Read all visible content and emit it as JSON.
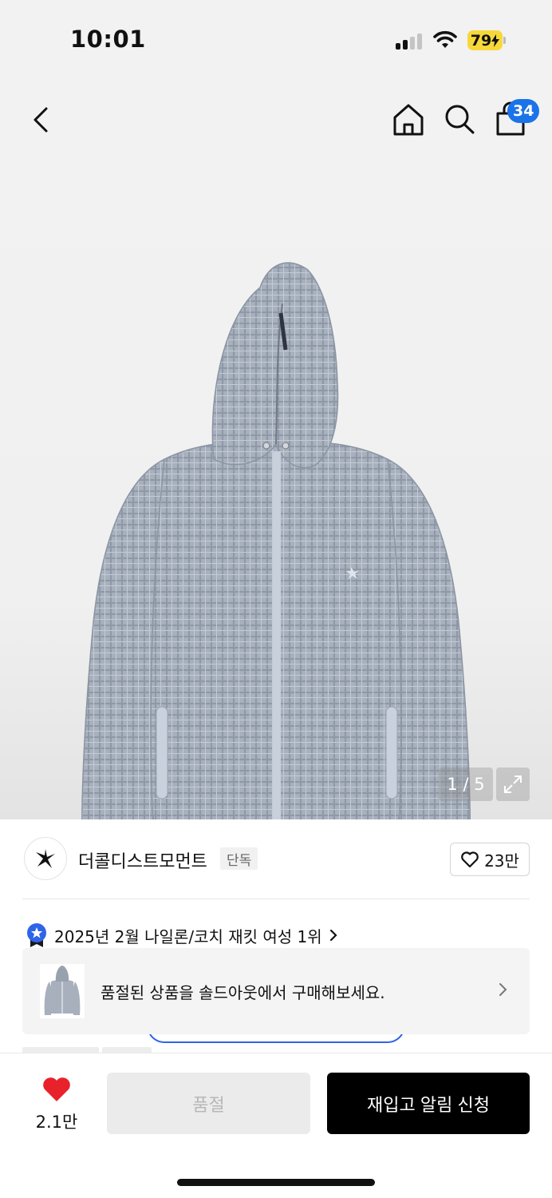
{
  "status_bar": {
    "time": "10:01",
    "battery": "79"
  },
  "nav": {
    "back_icon": "chevron-left-icon",
    "home_icon": "home-icon",
    "search_icon": "search-icon",
    "cart_icon": "shopping-bag-icon",
    "cart_count": "34"
  },
  "gallery": {
    "counter": "1 / 5",
    "expand_icon": "expand-icon"
  },
  "brand": {
    "name": "더콜디스트모먼트",
    "exclusive": "단독",
    "like_count": "23만"
  },
  "ranking": {
    "text": "2025년 2월 나일론/코치 재킷 여성 1위",
    "icon": "star-badge-icon"
  },
  "soldout_banner": {
    "text": "품절된 상품을 솔드아웃에서 구매해보세요."
  },
  "bottom_bar": {
    "wish_count": "2.1만",
    "soldout_label": "품절",
    "restock_label": "재입고 알림 신청"
  },
  "colors": {
    "accent_blue": "#1a73e8",
    "heart_red": "#e8222a",
    "battery_yellow": "#f7d83a",
    "jacket_gray": "#a9b3bf"
  }
}
